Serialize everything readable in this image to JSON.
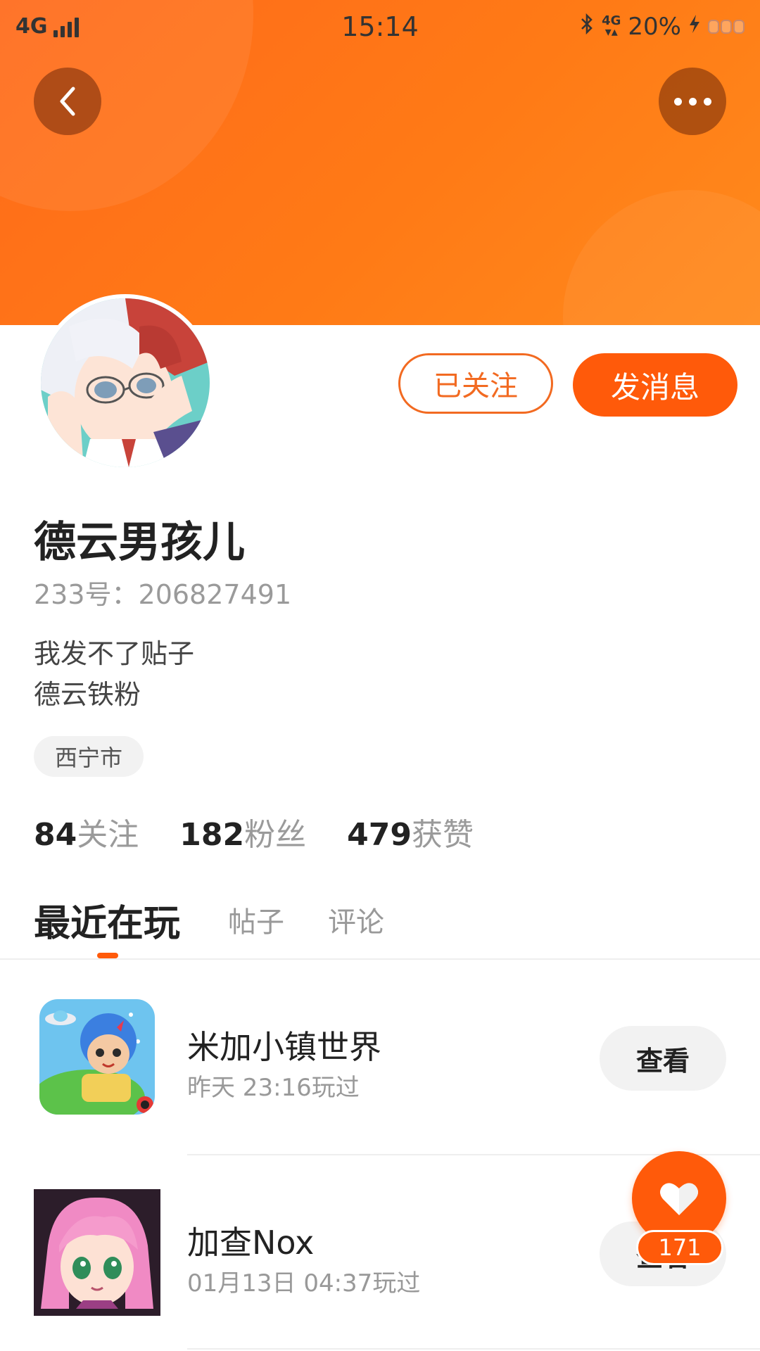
{
  "status_bar": {
    "network": "4G",
    "time": "15:14",
    "network_right": "4G",
    "battery": "20%"
  },
  "header": {
    "back_icon": "chevron-left-icon",
    "more_icon": "more-horizontal-icon",
    "gradient_start": "#ff6a1a",
    "gradient_end": "#ff8a1c"
  },
  "profile": {
    "name": "德云男孩儿",
    "uid": "233号：206827491",
    "bio_line1": "我发不了贴子",
    "bio_line2": "德云铁粉",
    "location": "西宁市",
    "follow_button": "已关注",
    "message_button": "发消息"
  },
  "stats": [
    {
      "num": "84",
      "label": "关注"
    },
    {
      "num": "182",
      "label": "粉丝"
    },
    {
      "num": "479",
      "label": "获赞"
    }
  ],
  "tabs": [
    {
      "label": "最近在玩",
      "active": true
    },
    {
      "label": "帖子",
      "active": false
    },
    {
      "label": "评论",
      "active": false
    }
  ],
  "games": [
    {
      "title": "米加小镇世界",
      "played": "昨天 23:16玩过",
      "action": "查看"
    },
    {
      "title": "加查Nox",
      "played": "01月13日 04:37玩过",
      "action": "查看"
    }
  ],
  "fab": {
    "icon": "heart-icon",
    "count": "171"
  },
  "colors": {
    "accent": "#ff5a0a",
    "follow_border": "#f26a21"
  }
}
